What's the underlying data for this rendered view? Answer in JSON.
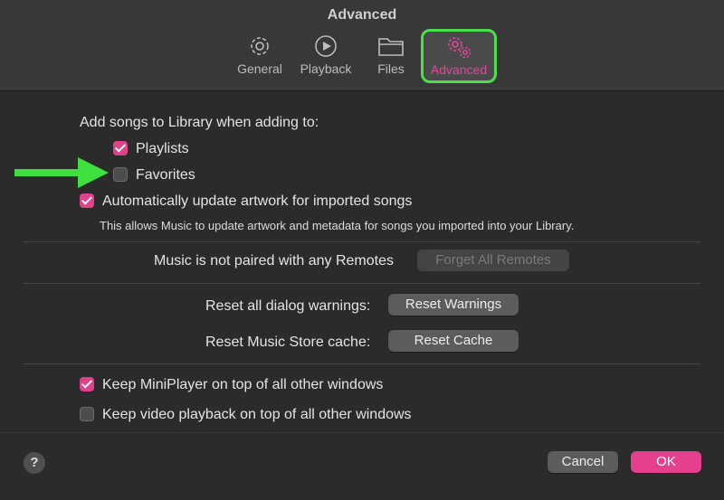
{
  "window": {
    "title": "Advanced"
  },
  "tabs": [
    {
      "label": "General",
      "icon": "gear-icon"
    },
    {
      "label": "Playback",
      "icon": "play-circle-icon"
    },
    {
      "label": "Files",
      "icon": "folder-icon"
    },
    {
      "label": "Advanced",
      "icon": "gears-icon",
      "active": true
    }
  ],
  "library": {
    "heading": "Add songs to Library when adding to:",
    "playlists": {
      "label": "Playlists",
      "checked": true
    },
    "favorites": {
      "label": "Favorites",
      "checked": false
    },
    "artwork": {
      "label": "Automatically update artwork for imported songs",
      "checked": true
    },
    "artwork_note": "This allows Music to update artwork and metadata for songs you imported into your Library."
  },
  "remotes": {
    "label": "Music is not paired with any Remotes",
    "button": "Forget All Remotes"
  },
  "reset": {
    "warnings_label": "Reset all dialog warnings:",
    "warnings_button": "Reset Warnings",
    "cache_label": "Reset Music Store cache:",
    "cache_button": "Reset Cache"
  },
  "windows": {
    "miniplayer": {
      "label": "Keep MiniPlayer on top of all other windows",
      "checked": true
    },
    "video": {
      "label": "Keep video playback on top of all other windows",
      "checked": false
    }
  },
  "footer": {
    "help": "?",
    "cancel": "Cancel",
    "ok": "OK"
  },
  "colors": {
    "accent": "#e4408e",
    "highlight": "#4be04b",
    "background": "#2b2b2b"
  }
}
